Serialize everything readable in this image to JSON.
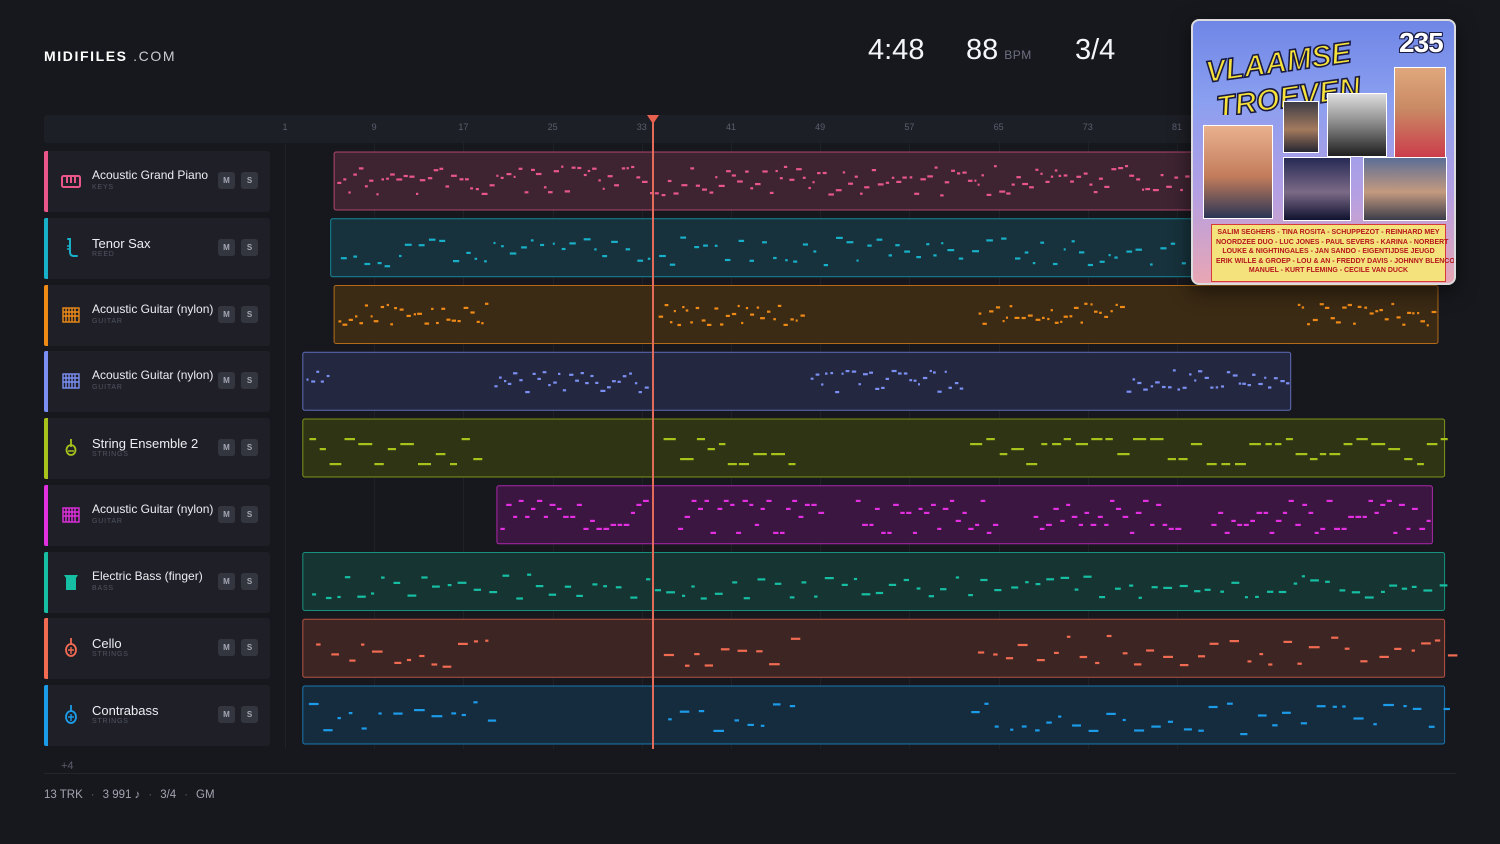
{
  "brand": {
    "name_bold": "MIDIFILES",
    "name_light": ".COM"
  },
  "transport": {
    "time": "4:48",
    "bpm": "88",
    "bpm_unit": "BPM",
    "meter": "3/4"
  },
  "ruler": {
    "ticks": [
      {
        "label": "1",
        "bar": 1
      },
      {
        "label": "9",
        "bar": 9
      },
      {
        "label": "17",
        "bar": 17
      },
      {
        "label": "25",
        "bar": 25
      },
      {
        "label": "33",
        "bar": 33
      },
      {
        "label": "41",
        "bar": 41
      },
      {
        "label": "49",
        "bar": 49
      },
      {
        "label": "57",
        "bar": 57
      },
      {
        "label": "65",
        "bar": 65
      },
      {
        "label": "73",
        "bar": 73
      },
      {
        "label": "81",
        "bar": 81
      }
    ],
    "playhead_bar": 34
  },
  "tracks": [
    {
      "name": "Acoustic Grand Piano",
      "category": "KEYS",
      "icon": "piano-keys-icon",
      "color": "#e9578a",
      "lane": "#3d2430",
      "mute": "M",
      "solo": "S",
      "regions": [
        [
          5.4,
          104.1
        ]
      ],
      "pattern": "dense"
    },
    {
      "name": "Tenor Sax",
      "category": "REED",
      "icon": "saxophone-icon",
      "color": "#18b0c9",
      "lane": "#17323c",
      "mute": "M",
      "solo": "S",
      "regions": [
        [
          5.1,
          104.1
        ]
      ],
      "pattern": "sparse"
    },
    {
      "name": "Acoustic Guitar (nylon)",
      "category": "GUITAR",
      "icon": "guitar-strings-icon",
      "color": "#ef8a17",
      "lane": "#3b2a14",
      "mute": "M",
      "solo": "S",
      "regions": [
        [
          5.4,
          104.4
        ]
      ],
      "pattern": "blocks"
    },
    {
      "name": "Acoustic Guitar (nylon)",
      "category": "GUITAR",
      "icon": "guitar-strings-icon",
      "color": "#7b8ff2",
      "lane": "#23273f",
      "mute": "M",
      "solo": "S",
      "regions": [
        [
          2.6,
          91.2
        ]
      ],
      "pattern": "blocks2"
    },
    {
      "name": "String Ensemble 2",
      "category": "STRINGS",
      "icon": "violin-icon",
      "color": "#a6c21b",
      "lane": "#2f3514",
      "mute": "M",
      "solo": "S",
      "regions": [
        [
          2.6,
          105.0
        ]
      ],
      "pattern": "dashes"
    },
    {
      "name": "Acoustic Guitar (nylon)",
      "category": "GUITAR",
      "icon": "guitar-strings-icon",
      "color": "#e22fe0",
      "lane": "#3a1640",
      "mute": "M",
      "solo": "S",
      "regions": [
        [
          20.0,
          103.9
        ]
      ],
      "pattern": "grid"
    },
    {
      "name": "Electric Bass (finger)",
      "category": "BASS",
      "icon": "bass-guitar-icon",
      "color": "#16bfa4",
      "lane": "#163532",
      "mute": "M",
      "solo": "S",
      "regions": [
        [
          2.6,
          105.0
        ]
      ],
      "pattern": "bass"
    },
    {
      "name": "Cello",
      "category": "STRINGS",
      "icon": "cello-icon",
      "color": "#f16a52",
      "lane": "#3d2523",
      "mute": "M",
      "solo": "S",
      "regions": [
        [
          2.6,
          105.0
        ]
      ],
      "pattern": "phrase"
    },
    {
      "name": "Contrabass",
      "category": "STRINGS",
      "icon": "contrabass-icon",
      "color": "#1c9be8",
      "lane": "#152c3f",
      "mute": "M",
      "solo": "S",
      "regions": [
        [
          2.6,
          105.0
        ]
      ],
      "pattern": "phrase"
    }
  ],
  "more_tracks": "+4",
  "footer": {
    "tracks": "13 TRK",
    "notes": "3 991 ♪",
    "meter": "3/4",
    "standard": "GM"
  },
  "album": {
    "title": "VLAAMSE TROEVEN",
    "number": "235",
    "artists": [
      "SALIM SEGHERS - TINA ROSITA - SCHUPPEZOT - REINHARD MEY",
      "NOORDZEE DUO - LUC JONES - PAUL SEVERS - KARINA - NORBERT",
      "LOUKE & NIGHTINGALES - JAN SANDO - EIGENTIJDSE JEUGD",
      "ERIK WILLE & GROEP - LOU & AN - FREDDY DAVIS - JOHNNY BLENCO",
      "MANUEL - KURT FLEMING - CECILE VAN DUCK"
    ]
  }
}
